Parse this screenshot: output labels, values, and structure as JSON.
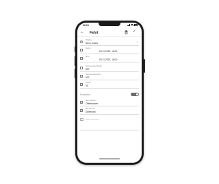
{
  "status_bar": {
    "time": "22:15"
  },
  "header": {
    "title": "Fahrt"
  },
  "fields": [
    {
      "label": "Mitfahrer",
      "value": "Stern, Andre",
      "icon": "person-icon"
    },
    {
      "label": "Beginn",
      "value": "09.11.2022, 15:00",
      "icon": "calendar-icon"
    },
    {
      "label": "Ende",
      "value": "09.11.2022, 16:00",
      "icon": "calendar-icon"
    },
    {
      "label": "Kilometerstand Beginn",
      "value": "897",
      "icon": "odometer-icon"
    },
    {
      "label": "Kilometerstand Ende",
      "value": "927",
      "icon": "odometer-icon"
    },
    {
      "label": "Distanz",
      "value": "30",
      "icon": "distance-icon"
    }
  ],
  "private_toggle": {
    "label": "Privatfahrt",
    "state": "off"
  },
  "locations": [
    {
      "label": "Start-Adresse",
      "value": "Oberhausen",
      "icon": "signpost-icon"
    },
    {
      "label": "Ziel-Adresse",
      "value": "Dortmund",
      "icon": "signpost-icon"
    }
  ],
  "note": {
    "placeholder": "Notiz zur Fahrt"
  },
  "colors": {
    "toggle": "#6b6b6b",
    "divider": "#d8d8d8",
    "label": "#8a8a8a"
  }
}
